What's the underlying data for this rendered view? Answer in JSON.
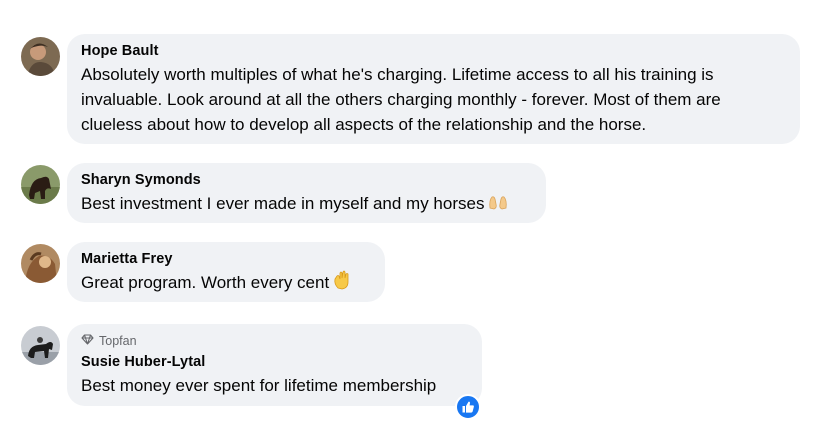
{
  "comments": [
    {
      "name": "Hope Bault",
      "text_lines": [
        "Absolutely worth multiples of what he's charging. Lifetime access to all his training is",
        "invaluable. Look around at all the others charging monthly - forever. Most of them are",
        "clueless about how to develop all aspects of the relationship and the horse."
      ]
    },
    {
      "name": "Sharyn Symonds",
      "text": "Best investment I ever made in myself and my horses",
      "emoji": "raising-hands-icon"
    },
    {
      "name": "Marietta Frey",
      "text": "Great program. Worth every cent",
      "emoji": "waving-hand-icon"
    },
    {
      "badge": "Topfan",
      "badge_icon": "diamond-icon",
      "name": "Susie Huber-Lytal",
      "text": "Best money ever spent for lifetime membership",
      "reaction": "like-icon"
    }
  ],
  "colors": {
    "bubble": "#f0f2f5",
    "text": "#050505",
    "secondary": "#65676b",
    "like": "#1877f2"
  }
}
